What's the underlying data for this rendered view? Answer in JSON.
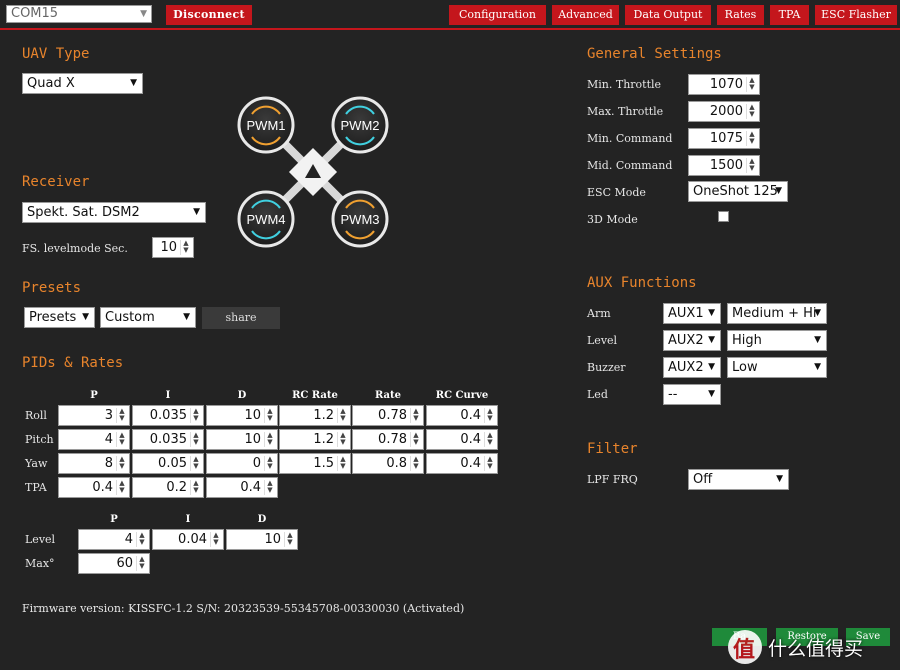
{
  "header": {
    "port": "COM15",
    "disconnect": "Disconnect",
    "tabs": [
      "Configuration",
      "Advanced",
      "Data Output",
      "Rates",
      "TPA",
      "ESC Flasher"
    ],
    "accent": "#c4161c"
  },
  "uav": {
    "title": "UAV Type",
    "type": "Quad X",
    "motors": [
      "PWM1",
      "PWM2",
      "PWM4",
      "PWM3"
    ]
  },
  "receiver": {
    "title": "Receiver",
    "type": "Spekt. Sat. DSM2",
    "fs_label": "FS. levelmode Sec.",
    "fs_value": "10"
  },
  "presets": {
    "title": "Presets",
    "preset": "Presets",
    "custom": "Custom",
    "share": "share"
  },
  "pids": {
    "title": "PIDs & Rates",
    "headers": [
      "P",
      "I",
      "D",
      "RC Rate",
      "Rate",
      "RC Curve"
    ],
    "rows": [
      {
        "label": "Roll",
        "values": [
          "3",
          "0.035",
          "10",
          "1.2",
          "0.78",
          "0.4"
        ]
      },
      {
        "label": "Pitch",
        "values": [
          "4",
          "0.035",
          "10",
          "1.2",
          "0.78",
          "0.4"
        ]
      },
      {
        "label": "Yaw",
        "values": [
          "8",
          "0.05",
          "0",
          "1.5",
          "0.8",
          "0.4"
        ]
      },
      {
        "label": "TPA",
        "values": [
          "0.4",
          "0.2",
          "0.4"
        ]
      }
    ]
  },
  "level": {
    "headers": [
      "P",
      "I",
      "D"
    ],
    "level_label": "Level",
    "level_values": [
      "4",
      "0.04",
      "10"
    ],
    "max_label": "Max°",
    "max_value": "60"
  },
  "general": {
    "title": "General Settings",
    "rows": [
      {
        "label": "Min. Throttle",
        "value": "1070"
      },
      {
        "label": "Max. Throttle",
        "value": "2000"
      },
      {
        "label": "Min. Command",
        "value": "1075"
      },
      {
        "label": "Mid. Command",
        "value": "1500"
      }
    ],
    "esc_label": "ESC Mode",
    "esc_value": "OneShot 125",
    "mode3d_label": "3D Mode"
  },
  "aux": {
    "title": "AUX Functions",
    "rows": [
      {
        "label": "Arm",
        "channel": "AUX1",
        "range": "Medium + Hi"
      },
      {
        "label": "Level",
        "channel": "AUX2",
        "range": "High"
      },
      {
        "label": "Buzzer",
        "channel": "AUX2",
        "range": "Low"
      },
      {
        "label": "Led",
        "channel": "--",
        "range": ""
      }
    ]
  },
  "filter": {
    "title": "Filter",
    "lpf_label": "LPF FRQ",
    "lpf_value": "Off"
  },
  "firmware": "Firmware version: KISSFC-1.2 S/N: 20323539-55345708-00330030 (Activated)",
  "footer": {
    "backup": "Ba",
    "restore": "Restore",
    "save": "Save",
    "watermark": "什么值得买"
  }
}
